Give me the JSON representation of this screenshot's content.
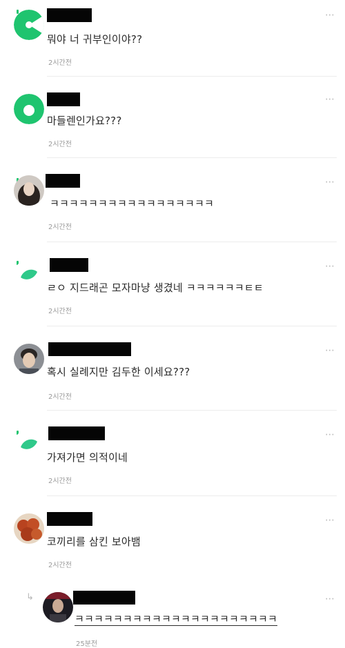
{
  "comments": [
    {
      "text": "뭐야 너 귀부인이야??",
      "time": "2시간전",
      "avatar": "green-pacman-icon"
    },
    {
      "text": "마들렌인가요???",
      "time": "2시간전",
      "avatar": "green-ring-icon"
    },
    {
      "text": "ㅋㅋㅋㅋㅋㅋㅋㅋㅋㅋㅋㅋㅋㅋㅋㅋㅋ",
      "time": "2시간전",
      "avatar": "woman-photo"
    },
    {
      "text": "ㄹㅇ 지드래곤 모자마냥 생겼네 ㅋㅋㅋㅋㅋㅋㅌㅌ",
      "time": "2시간전",
      "avatar": "leaf-icon"
    },
    {
      "text": "혹시 실례지만 김두한 이세요???",
      "time": "2시간전",
      "avatar": "man-photo"
    },
    {
      "text": "가져가면 의적이네",
      "time": "2시간전",
      "avatar": "leaf-icon"
    },
    {
      "text": "코끼리를 삼킨 보아뱀",
      "time": "2시간전",
      "avatar": "food-photo"
    }
  ],
  "reply": {
    "text": "ㅋㅋㅋㅋㅋㅋㅋㅋㅋㅋㅋㅋㅋㅋㅋㅋㅋㅋㅋㅋㅋ",
    "time": "25분전",
    "avatar": "person-dark-photo"
  },
  "more_glyph": "⋯",
  "reply_arrow": "↳",
  "colors": {
    "accent": "#1fc46f",
    "text": "#2a2a2a",
    "time": "#9a9a9a"
  }
}
